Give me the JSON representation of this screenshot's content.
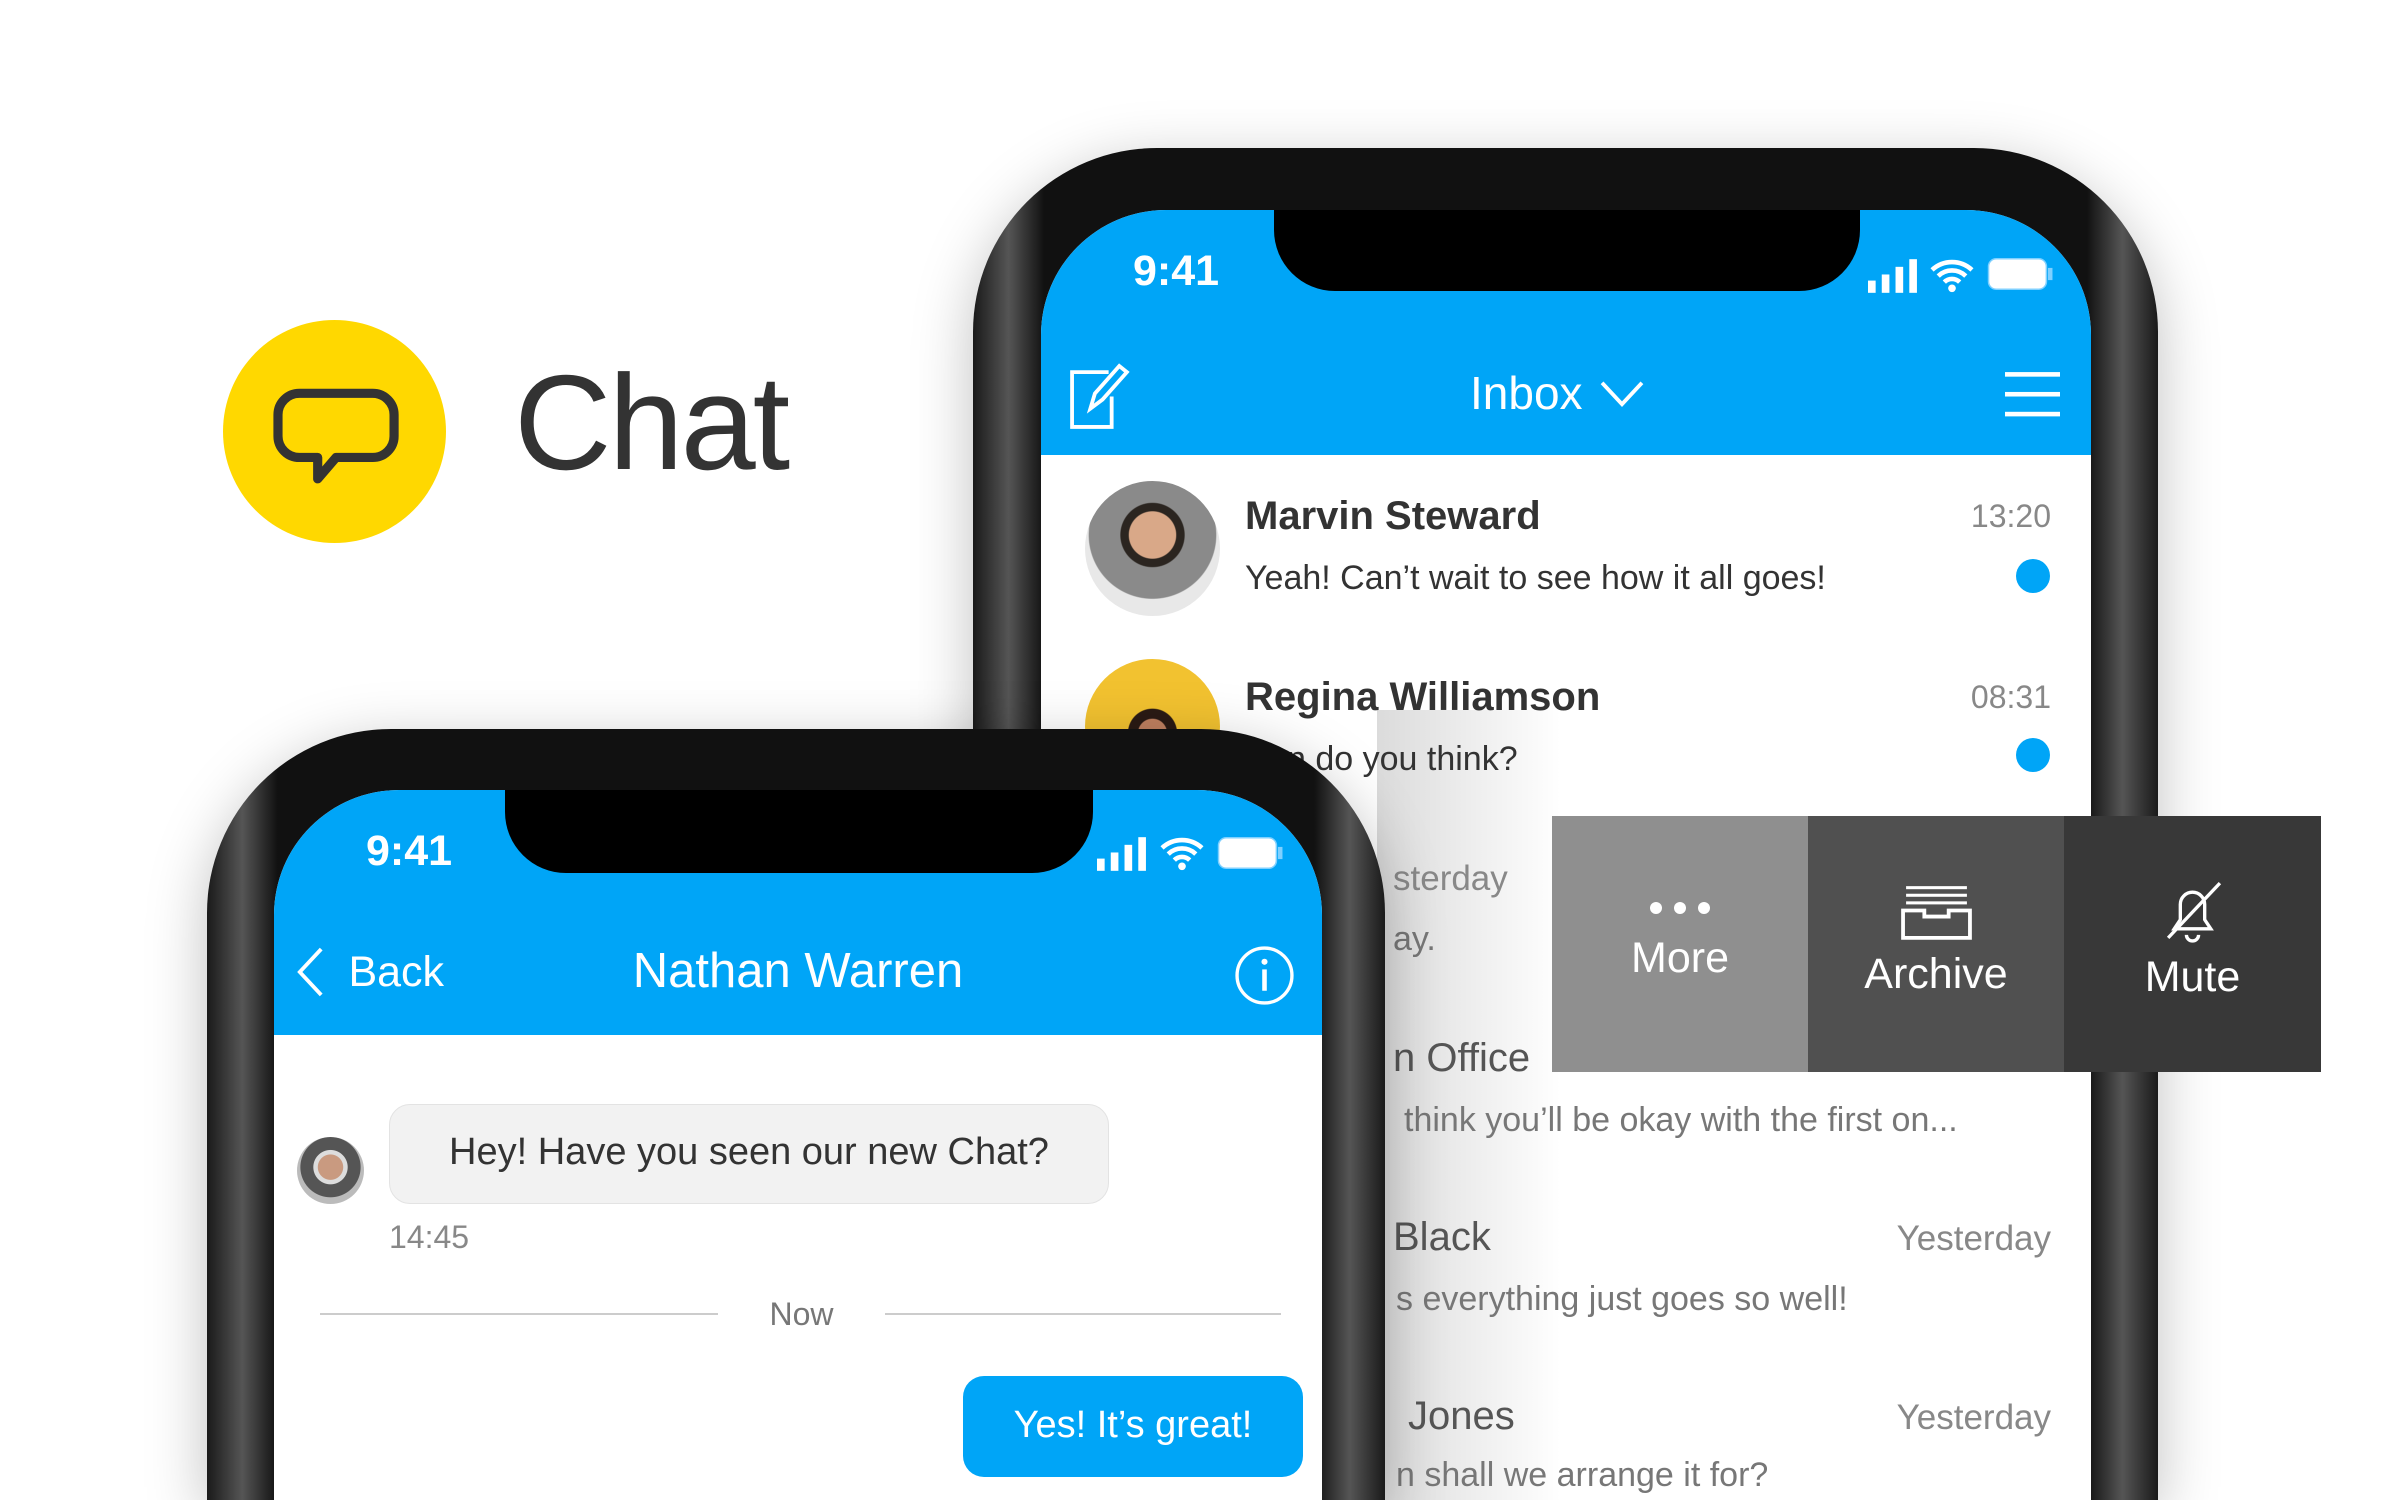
{
  "brand": {
    "title": "Chat",
    "accent": "#ffd800",
    "icon": "speech-bubble-icon"
  },
  "inbox_phone": {
    "status": {
      "time": "9:41"
    },
    "header": {
      "title": "Inbox",
      "compose_icon": "compose-icon",
      "menu_icon": "hamburger-icon",
      "color": "#00a5f7"
    },
    "conversations": [
      {
        "name": "Marvin Steward",
        "message": "Yeah! Can’t wait to see how it all goes!",
        "time": "13:20",
        "unread": true
      },
      {
        "name": "Regina Williamson",
        "message": "n do you think?",
        "time": "08:31",
        "unread": true
      },
      {
        "name": "",
        "message": "ay.",
        "time": "sterday",
        "unread": false
      },
      {
        "name": "n Office",
        "message": "think you’ll be okay with the first on...",
        "time": "",
        "unread": false
      },
      {
        "name": "Black",
        "message": "s everything just goes so well!",
        "time": "Yesterday",
        "unread": false
      },
      {
        "name": "Jones",
        "message": "n shall we arrange it for?",
        "time": "Yesterday",
        "unread": false
      }
    ],
    "swipe_actions": [
      {
        "label": "More",
        "icon": "more-dots-icon",
        "color": "#8f8f8f"
      },
      {
        "label": "Archive",
        "icon": "archive-icon",
        "color": "#505050"
      },
      {
        "label": "Mute",
        "icon": "bell-off-icon",
        "color": "#383838"
      }
    ]
  },
  "chat_phone": {
    "status": {
      "time": "9:41"
    },
    "header": {
      "back_label": "Back",
      "title": "Nathan Warren",
      "info_icon": "info-icon"
    },
    "messages": [
      {
        "direction": "incoming",
        "text": "Hey! Have you seen our new Chat?",
        "time": "14:45"
      },
      {
        "direction": "outgoing",
        "text": "Yes! It’s great!"
      }
    ],
    "divider_label": "Now"
  }
}
